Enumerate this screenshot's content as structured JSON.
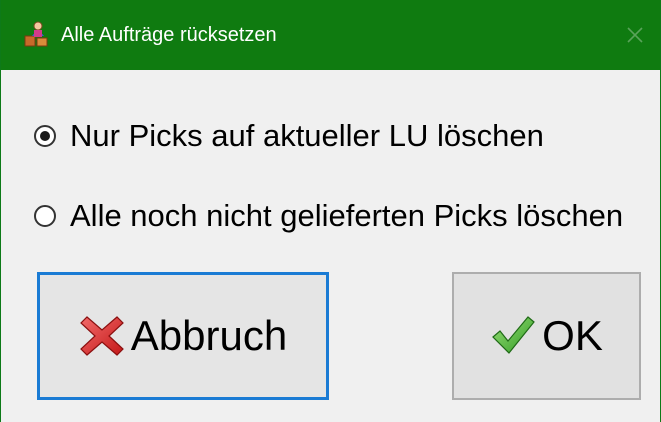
{
  "window": {
    "title": "Alle Aufträge rücksetzen",
    "app_icon": "warehouse-worker-icon",
    "close_icon": "close-icon"
  },
  "options": [
    {
      "label": "Nur Picks auf aktueller LU löschen",
      "checked": true
    },
    {
      "label": "Alle noch nicht gelieferten Picks löschen",
      "checked": false
    }
  ],
  "buttons": {
    "cancel_label": "Abbruch",
    "cancel_icon": "red-x-icon",
    "ok_label": "OK",
    "ok_icon": "green-check-icon"
  },
  "colors": {
    "titlebar": "#0f7b10",
    "focus_border": "#1a7bd4"
  }
}
